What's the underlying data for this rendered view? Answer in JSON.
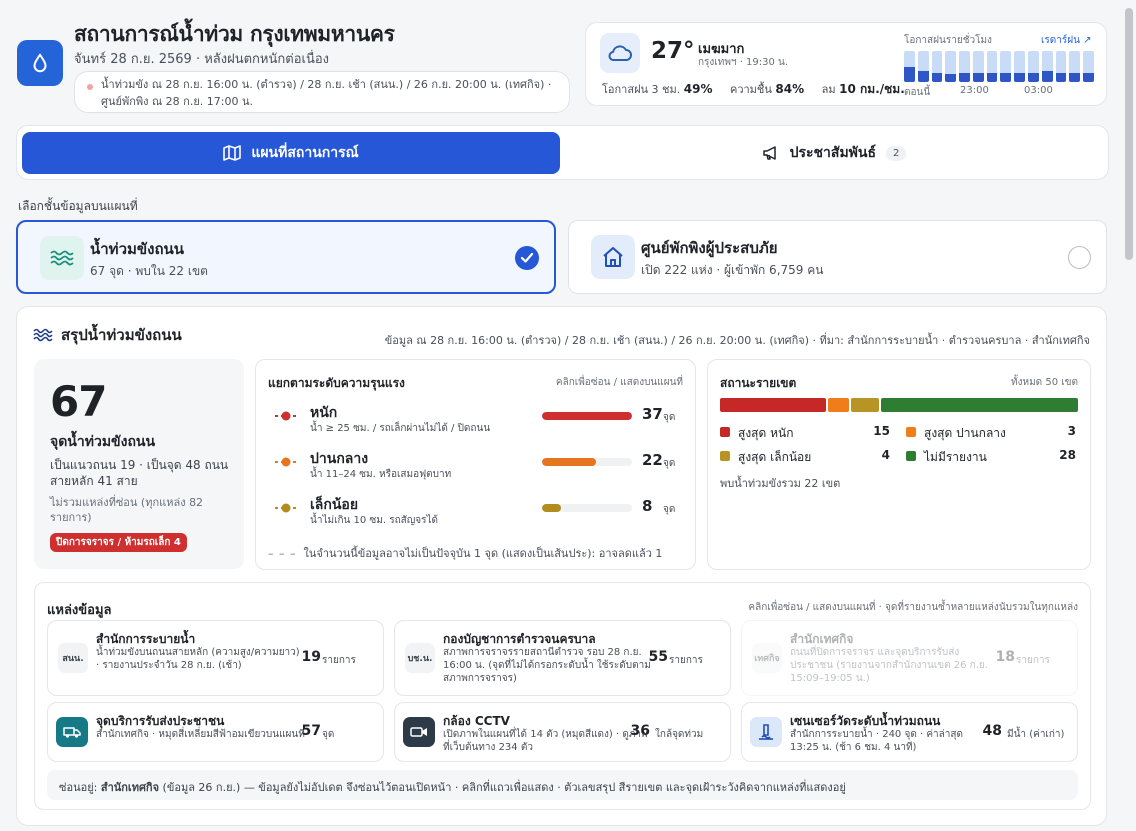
{
  "header": {
    "title": "สถานการณ์น้ำท่วม กรุงเทพมหานคร",
    "subtitle": "จันทร์ 28 ก.ย. 2569 · หลังฝนตกหนักต่อเนื่อง",
    "source_line1": "น้ำท่วมขัง ณ 28 ก.ย. 16:00 น. (ตำรวจ) / 28 ก.ย. เช้า (สนน.) / 26 ก.ย. 20:00 น. (เทศกิจ) ·",
    "source_line2": "ศูนย์พักพิง ณ 28 ก.ย. 17:00 น."
  },
  "weather": {
    "temp": "27°",
    "condition": "เมฆมาก",
    "location_time": "กรุงเทพฯ · 19:30 น.",
    "rain_chance_label": "โอกาสฝน 3 ชม.",
    "rain_chance": "49%",
    "humidity_label": "ความชื้น",
    "humidity": "84%",
    "wind_label": "ลม",
    "wind": "10 กม./ชม.",
    "hourly_title": "โอกาสฝนรายชั่วโมง",
    "radar_link": "เรดาร์ฝน ↗",
    "hourly_levels": [
      0.5,
      0.35,
      0.3,
      0.25,
      0.3,
      0.3,
      0.3,
      0.3,
      0.3,
      0.3,
      0.35,
      0.3,
      0.3,
      0.3
    ],
    "axis_labels": [
      "ตอนนี้",
      "23:00",
      "03:00"
    ]
  },
  "tabs": {
    "map_label": "แผนที่สถานการณ์",
    "pr_label": "ประชาสัมพันธ์",
    "pr_count": "2"
  },
  "layers": {
    "label": "เลือกชั้นข้อมูลบนแผนที่",
    "flood_title": "น้ำท่วมขังถนน",
    "flood_sub": "67 จุด · พบใน 22 เขต",
    "shelter_title": "ศูนย์พักพิงผู้ประสบภัย",
    "shelter_sub": "เปิด 222 แห่ง · ผู้เข้าพัก 6,759 คน"
  },
  "summary": {
    "title": "สรุปน้ำท่วมขังถนน",
    "meta": "ข้อมูล ณ 28 ก.ย. 16:00 น. (ตำรวจ) / 28 ก.ย. เช้า (สนน.) / 26 ก.ย. 20:00 น. (เทศกิจ) · ที่มา: สำนักการระบายน้ำ · ตำรวจนครบาล · สำนักเทศกิจ",
    "total": "67",
    "total_label": "จุดน้ำท่วมขังถนน",
    "total_detail": "เป็นแนวถนน 19 · เป็นจุด 48 ถนนสายหลัก 41 สาย",
    "total_excluded": "ไม่รวมแหล่งที่ซ่อน (ทุกแหล่ง 82 รายการ)",
    "closure_badge": "ปิดการจราจร / ห้ามรถเล็ก 4"
  },
  "severity": {
    "title": "แยกตามระดับความรุนแรง",
    "hint": "คลิกเพื่อซ่อน / แสดงบนแผนที่",
    "unit": "จุด",
    "max": 37,
    "rows": [
      {
        "name": "หนัก",
        "desc": "น้ำ ≥ 25 ซม. / รถเล็กผ่านไม่ได้ / ปิดถนน",
        "value": 37,
        "color": "#cf2f2f"
      },
      {
        "name": "ปานกลาง",
        "desc": "น้ำ 11–24 ซม. หรือเสมอฟุตบาท",
        "value": 22,
        "color": "#e5761f"
      },
      {
        "name": "เล็กน้อย",
        "desc": "น้ำไม่เกิน 10 ซม. รถสัญจรได้",
        "value": 8,
        "color": "#b08d1c"
      }
    ],
    "note": "ในจำนวนนี้ข้อมูลอาจไม่เป็นปัจจุบัน 1 จุด (แสดงเป็นเส้นประ): อาจลดแล้ว 1"
  },
  "districts": {
    "title": "สถานะรายเขต",
    "total_label": "ทั้งหมด 50 เขต",
    "items": [
      {
        "name": "สูงสุด หนัก",
        "value": 15,
        "color": "#c62828"
      },
      {
        "name": "สูงสุด ปานกลาง",
        "value": 3,
        "color": "#ef7d1a"
      },
      {
        "name": "สูงสุด เล็กน้อย",
        "value": 4,
        "color": "#b89424"
      },
      {
        "name": "ไม่มีรายงาน",
        "value": 28,
        "color": "#2e7d32"
      }
    ],
    "found": "พบน้ำท่วมขังรวม 22 เขต"
  },
  "sources": {
    "title": "แหล่งข้อมูล",
    "hint": "คลิกเพื่อซ่อน / แสดงบนแผนที่ · จุดที่รายงานซ้ำหลายแหล่งนับรวมในทุกแหล่ง",
    "items": [
      {
        "abbr": "สนน.",
        "name": "สำนักการระบายน้ำ",
        "desc": "น้ำท่วมขังบนถนนสายหลัก (ความสูง/ความยาว) · รายงานประจำวัน 28 ก.ย. (เช้า)",
        "value": "19",
        "unit": "รายการ"
      },
      {
        "abbr": "บช.น.",
        "name": "กองบัญชาการตำรวจนครบาล",
        "desc": "สภาพการจราจรรายสถานีตำรวจ รอบ 28 ก.ย. 16:00 น. (จุดที่ไม่ได้กรอกระดับน้ำ ใช้ระดับตามสภาพการจราจร)",
        "value": "55",
        "unit": "รายการ"
      },
      {
        "abbr": "เทศกิจ",
        "name": "สำนักเทศกิจ",
        "desc": "ถนนที่ปิดการจราจร และจุดบริการรับส่งประชาชน (รายงานจากสำนักงานเขต 26 ก.ย. 15:09–19:05 น.)",
        "value": "18",
        "unit": "รายการ"
      },
      {
        "name": "จุดบริการรับส่งประชาชน",
        "desc": "สำนักเทศกิจ · หมุดสี่เหลี่ยมสีฟ้าอมเขียวบนแผนที่",
        "value": "57",
        "unit": "จุด"
      },
      {
        "name": "กล้อง CCTV",
        "desc": "เปิดภาพในแผนที่ได้ 14 ตัว (หมุดสีแดง) · ดูภาพที่เว็บต้นทาง 234 ตัว",
        "value": "36",
        "unit": "ใกล้จุดท่วม"
      },
      {
        "name": "เซนเซอร์วัดระดับน้ำท่วมถนน",
        "desc": "สำนักการระบายน้ำ · 240 จุด · ค่าล่าสุด 13:25 น. (ช้า 6 ชม. 4 นาที)",
        "value": "48",
        "unit": "มีน้ำ (ค่าเก่า)"
      }
    ],
    "hidden_prefix": "ซ่อนอยู่: ",
    "hidden_name": "สำนักเทศกิจ",
    "hidden_rest": " (ข้อมูล 26 ก.ย.) — ข้อมูลยังไม่อัปเดต จึงซ่อนไว้ตอนเปิดหน้า · คลิกที่แถวเพื่อแสดง · ตัวเลขสรุป สีรายเขต และจุดเฝ้าระวังคิดจากแหล่งที่แสดงอยู่"
  }
}
